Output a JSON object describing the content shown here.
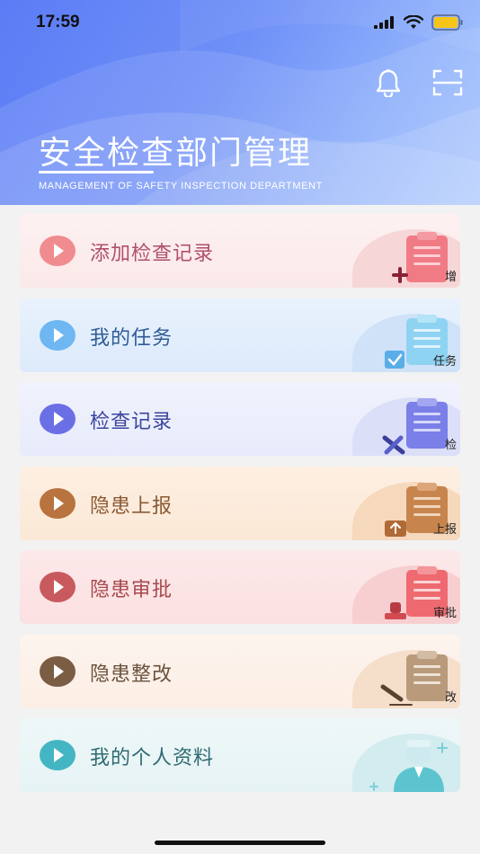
{
  "status_bar": {
    "time": "17:59"
  },
  "header": {
    "title": "安全检查部门管理",
    "subtitle": "MANAGEMENT OF SAFETY INSPECTION DEPARTMENT"
  },
  "menu": [
    {
      "label": "添加检查记录",
      "tag": "增",
      "color": "#b0506a",
      "play": "#f08b8f",
      "accent": "#f07b85"
    },
    {
      "label": "我的任务",
      "tag": "任务",
      "color": "#2f5b96",
      "play": "#6fb7f2",
      "accent": "#74c5ee"
    },
    {
      "label": "检查记录",
      "tag": "检",
      "color": "#3c45a0",
      "play": "#6a6fe6",
      "accent": "#7b7fe8"
    },
    {
      "label": "隐患上报",
      "tag": "上报",
      "color": "#8a5a33",
      "play": "#b8733f",
      "accent": "#c7854d"
    },
    {
      "label": "隐患审批",
      "tag": "审批",
      "color": "#a64a4f",
      "play": "#c85a5e",
      "accent": "#ee6a70"
    },
    {
      "label": "隐患整改",
      "tag": "改",
      "color": "#6a523c",
      "play": "#7b5d44",
      "accent": "#b99b7c"
    },
    {
      "label": "我的个人资料",
      "tag": "",
      "color": "#2e6a72",
      "play": "#44b5c3",
      "accent": "#5cc4cf"
    }
  ]
}
